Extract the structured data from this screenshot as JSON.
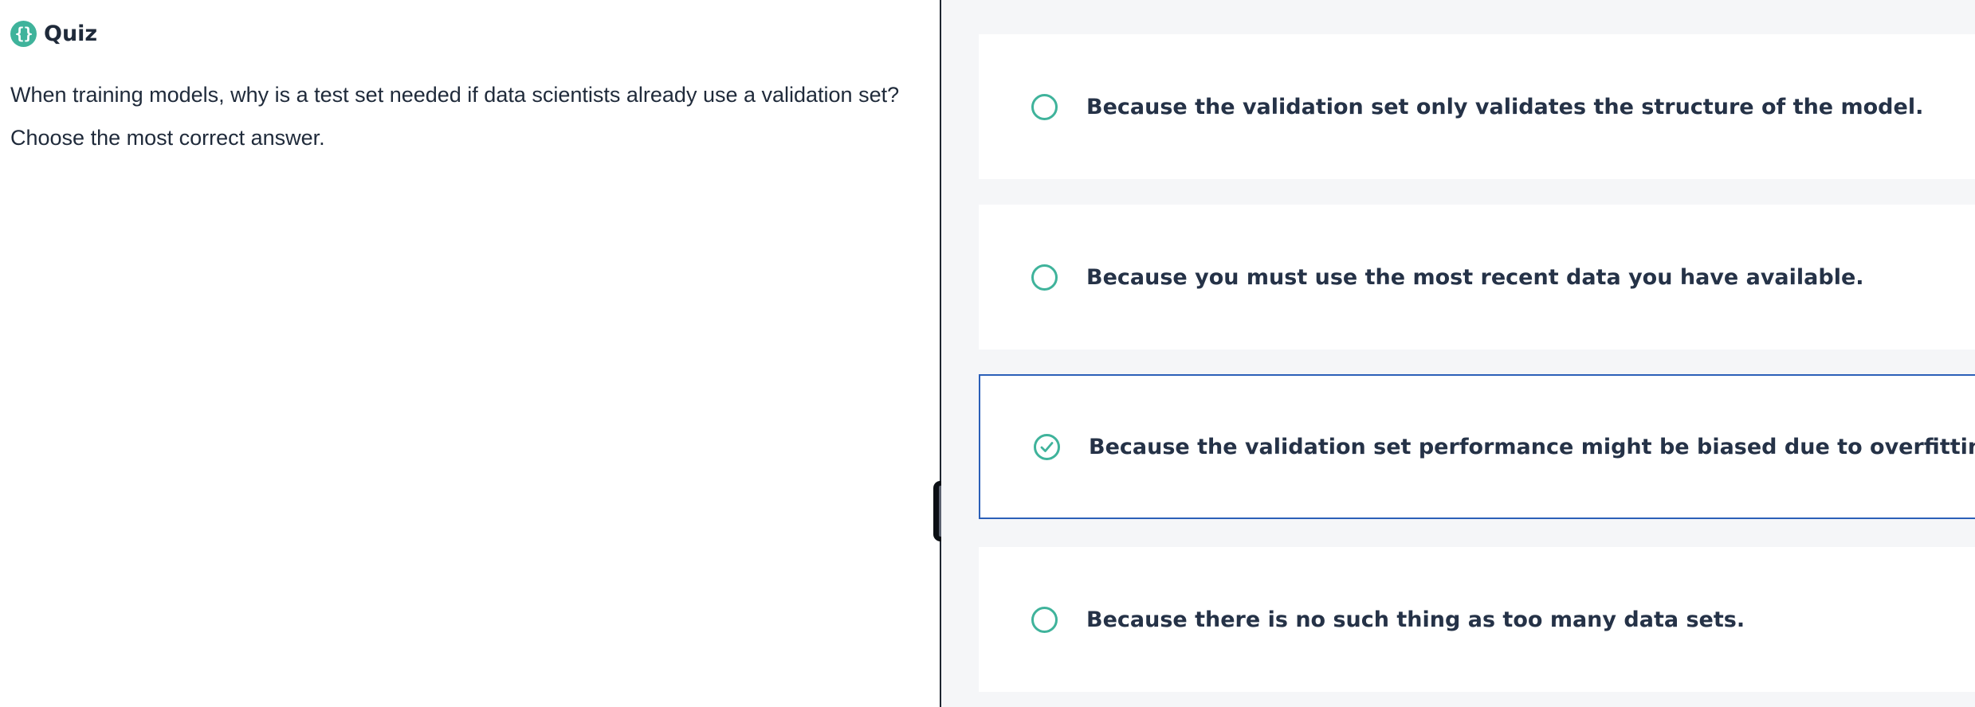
{
  "quiz": {
    "title": "Quiz",
    "icon": "curly-braces-icon",
    "icon_glyph": "{}",
    "question": "When training models, why is a test set needed if data scientists already use a validation set? Choose the most correct answer."
  },
  "options": [
    {
      "label": "Because the validation set only validates the structure of the model.",
      "selected": false
    },
    {
      "label": "Because you must use the most recent data you have available.",
      "selected": false
    },
    {
      "label": "Because the validation set performance might be biased due to overfitting.",
      "selected": true
    },
    {
      "label": "Because there is no such thing as too many data sets.",
      "selected": false
    }
  ],
  "colors": {
    "accent": "#3fb39b",
    "selected_border": "#2b5fb8",
    "text": "#1f2a3a",
    "right_background": "#f5f6f8"
  }
}
